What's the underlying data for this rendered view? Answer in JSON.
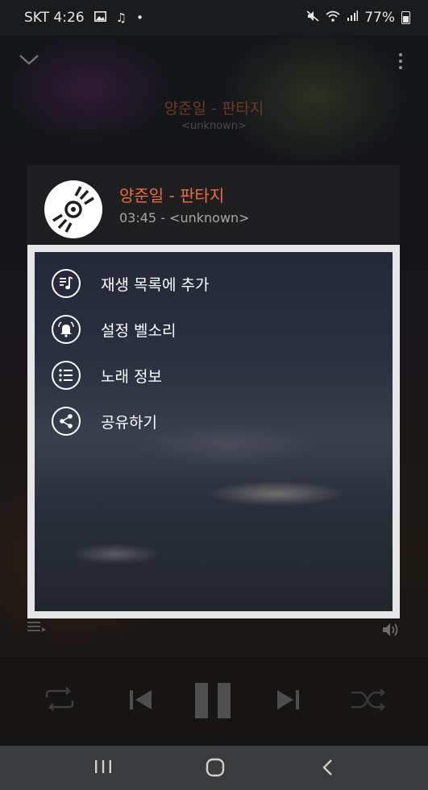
{
  "status_bar": {
    "carrier": "SKT",
    "time": "4:26",
    "battery": "77%",
    "left_icons": [
      "gallery-icon",
      "music-note-icon",
      "dot-icon"
    ],
    "right_icons": [
      "mute-vibrate-icon",
      "wifi-icon",
      "signal-icon",
      "battery-icon"
    ]
  },
  "player": {
    "title": "양준일 - 판타지",
    "subtitle": "<unknown>"
  },
  "dialog": {
    "title": "양준일 - 판타지",
    "meta": "03:45 - <unknown>",
    "menu": [
      {
        "label": "재생 목록에 추가",
        "icon": "add-to-playlist-icon"
      },
      {
        "label": "설정 벨소리",
        "icon": "ringtone-bell-icon"
      },
      {
        "label": "노래 정보",
        "icon": "song-info-icon"
      },
      {
        "label": "공유하기",
        "icon": "share-icon"
      }
    ]
  },
  "colors": {
    "accent": "#ec6b3b",
    "dialog_header": "#1f1f21",
    "dialog_frame": "#e6e6e6",
    "nav_bar": "#3a3b3d"
  }
}
